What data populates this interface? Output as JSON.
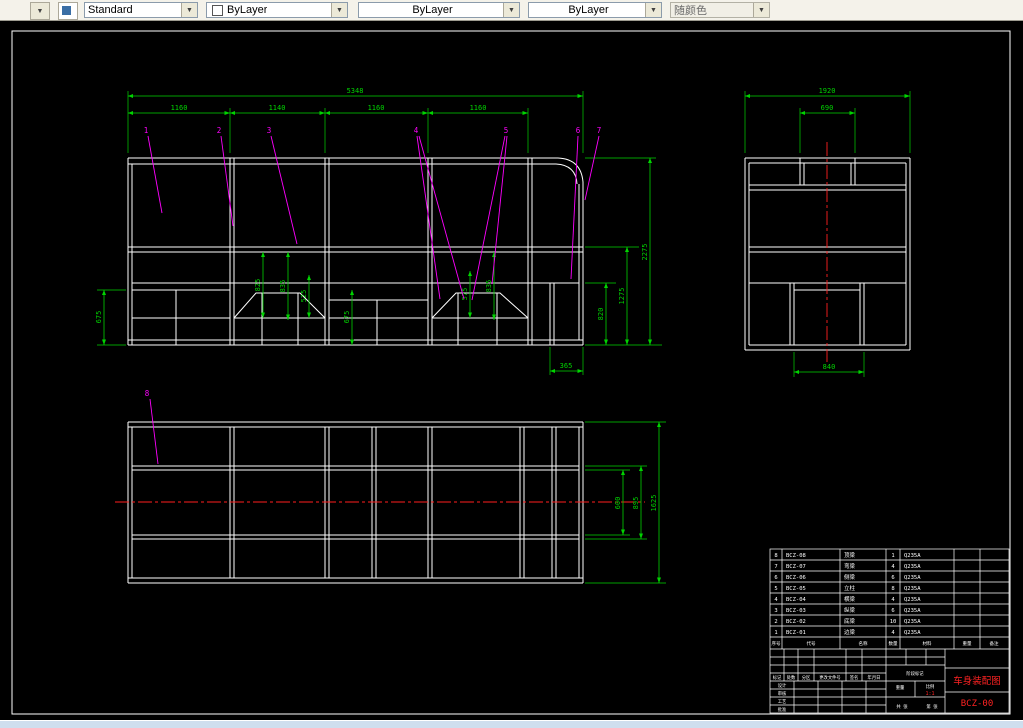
{
  "toolbar": {
    "style_value": "Standard",
    "color_value": "ByLayer",
    "linetype_value": "ByLayer",
    "lineweight_value": "ByLayer",
    "plotstyle_value": "随颜色"
  },
  "colors": {
    "line_white": "#ffffff",
    "dim_green": "#00d400",
    "leader_magenta": "#ff00ff",
    "centerline_red": "#ff1e1e",
    "title_red": "#ff2222",
    "canvas_black": "#000000"
  },
  "drawing": {
    "main_view": {
      "dim_total": "5348",
      "seg1": "1160",
      "seg2": "1140",
      "seg3": "1160",
      "seg4": "1160",
      "h_total": "2275",
      "h_mid": "1275",
      "h_door": "820",
      "left": "675",
      "i1": "825",
      "i2": "835",
      "i3": "525",
      "i4": "675",
      "i5": "575",
      "i6": "835",
      "bottom": "365",
      "b1": "1",
      "b2": "2",
      "b3": "3",
      "b4": "4",
      "b5": "5",
      "b6": "6",
      "b7": "7"
    },
    "end_view": {
      "dim_total": "1920",
      "dim_top": "690",
      "dim_bottom": "840"
    },
    "plan_view": {
      "dim_total": "1625",
      "dim_mid": "895",
      "dim_inner": "600",
      "b8": "8"
    }
  },
  "titleblock": {
    "header": [
      "序号",
      "代号",
      "名称",
      "数量",
      "材料",
      "重量",
      "备注"
    ],
    "parts": [
      {
        "no": "8",
        "code": "BCZ-08",
        "name": "顶梁",
        "qty": "1",
        "mat": "Q235A"
      },
      {
        "no": "7",
        "code": "BCZ-07",
        "name": "弯梁",
        "qty": "4",
        "mat": "Q235A"
      },
      {
        "no": "6",
        "code": "BCZ-06",
        "name": "侧梁",
        "qty": "6",
        "mat": "Q235A"
      },
      {
        "no": "5",
        "code": "BCZ-05",
        "name": "立柱",
        "qty": "8",
        "mat": "Q235A"
      },
      {
        "no": "4",
        "code": "BCZ-04",
        "name": "横梁",
        "qty": "4",
        "mat": "Q235A"
      },
      {
        "no": "3",
        "code": "BCZ-03",
        "name": "纵梁",
        "qty": "6",
        "mat": "Q235A"
      },
      {
        "no": "2",
        "code": "BCZ-02",
        "name": "底梁",
        "qty": "10",
        "mat": "Q235A"
      },
      {
        "no": "1",
        "code": "BCZ-01",
        "name": "边梁",
        "qty": "4",
        "mat": "Q235A"
      }
    ],
    "labels": {
      "mark": "标记",
      "count": "处数",
      "zone": "分区",
      "doc": "更改文件号",
      "sign": "签名",
      "date": "年月日",
      "design": "设计",
      "check": "审核",
      "process": "工艺",
      "approve": "批准",
      "stage": "阶段标记",
      "weight": "重量",
      "scale": "比例",
      "sheets": "共 张",
      "page": "第 张"
    },
    "title_red": "车身装配图",
    "dwg_no_red": "BCZ-00",
    "scale_red": "1:1"
  }
}
